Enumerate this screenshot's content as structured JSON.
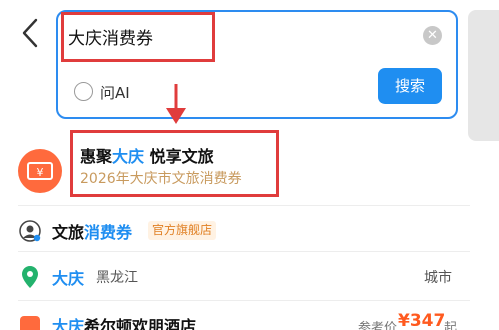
{
  "search": {
    "query": "大庆消费券",
    "ask_ai_label": "问AI",
    "search_button": "搜索"
  },
  "results": [
    {
      "title_pre": "惠聚",
      "title_hl": "大庆",
      "title_post": " 悦享文旅",
      "subtitle": "2026年大庆市文旅消费券"
    },
    {
      "title_pre": "文旅",
      "title_hl": "消费券",
      "badge": "官方旗舰店"
    },
    {
      "title": "大庆",
      "region": "黑龙江",
      "type": "城市"
    },
    {
      "title_hl": "大庆",
      "title_post": "希尔顿欢朋酒店",
      "price_label": "参考价",
      "price": "¥347",
      "price_suffix": "起"
    }
  ],
  "colors": {
    "accent": "#1f8ef1",
    "annotation_red": "#e03c3c",
    "brand_orange": "#ff6a3d",
    "subtitle_gold": "#c89a5e",
    "price_orange": "#ff5a1f"
  }
}
